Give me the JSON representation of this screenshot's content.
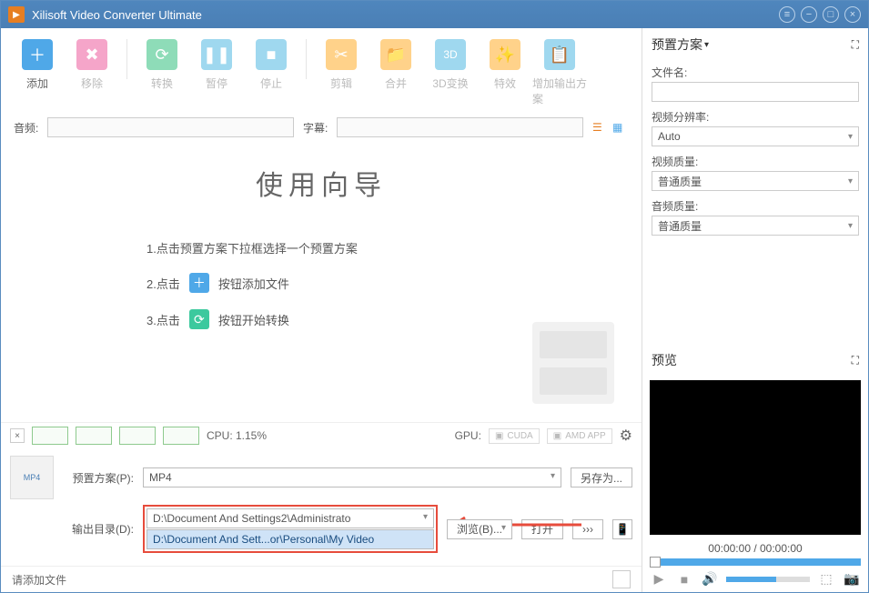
{
  "title": "Xilisoft Video Converter Ultimate",
  "toolbar": {
    "add": "添加",
    "remove": "移除",
    "convert": "转换",
    "pause": "暂停",
    "stop": "停止",
    "cut": "剪辑",
    "merge": "合并",
    "3d": "3D变换",
    "effect": "特效",
    "addProfile": "增加输出方案"
  },
  "avrow": {
    "audio": "音频:",
    "subtitle": "字幕:"
  },
  "wizard": {
    "title": "使用向导",
    "step1": "1.点击预置方案下拉框选择一个预置方案",
    "step2a": "2.点击",
    "step2b": "按钮添加文件",
    "step3a": "3.点击",
    "step3b": "按钮开始转换"
  },
  "sys": {
    "cpu": "CPU: 1.15%",
    "gpu": "GPU:",
    "cuda": "CUDA",
    "amd": "AMD APP"
  },
  "bottom": {
    "profileLabel": "预置方案(P):",
    "profileValue": "MP4",
    "saveAs": "另存为...",
    "outputLabel": "输出目录(D):",
    "outputValue": "D:\\Document And Settings2\\Administrato",
    "outputHint": "D:\\Document And Sett...or\\Personal\\My Video",
    "browse": "浏览(B)...",
    "open": "打开",
    "more": "›››"
  },
  "status": "请添加文件",
  "right": {
    "presetTitle": "预置方案",
    "fileName": "文件名:",
    "resolution": "视频分辨率:",
    "resolutionVal": "Auto",
    "vquality": "视频质量:",
    "vqualityVal": "普通质量",
    "aquality": "音频质量:",
    "aqualityVal": "普通质量",
    "previewTitle": "预览",
    "time": "00:00:00 / 00:00:00"
  }
}
